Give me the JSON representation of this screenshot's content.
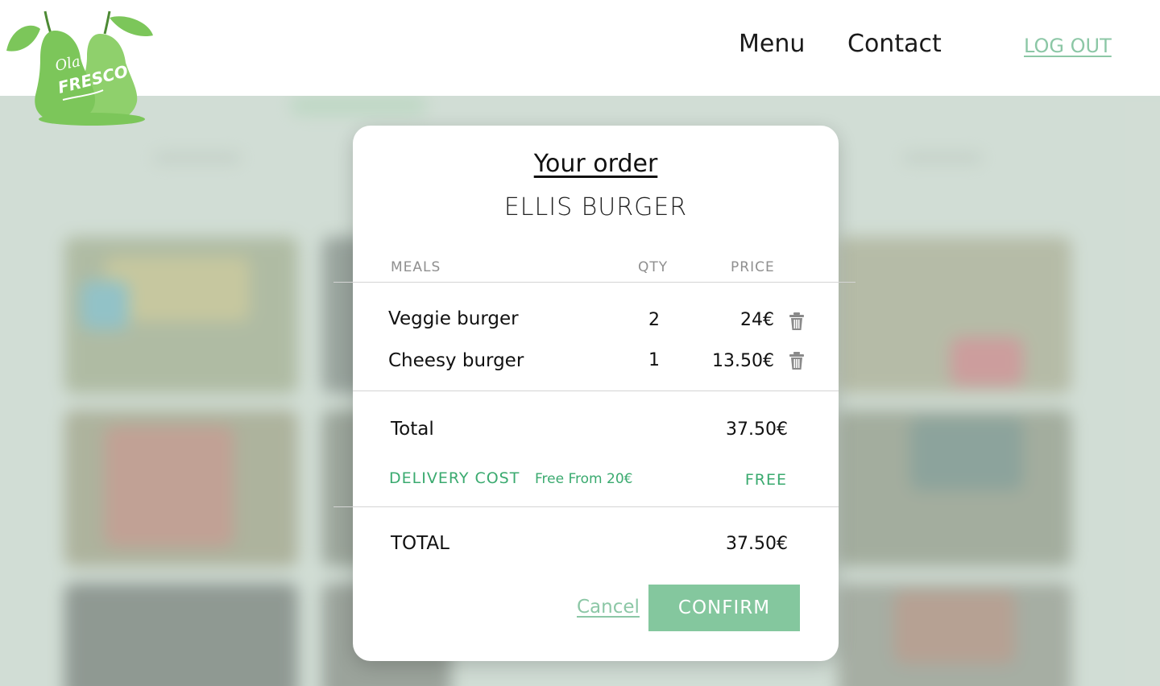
{
  "header": {
    "logo_alt": "Ola Fresco",
    "nav": {
      "menu": "Menu",
      "contact": "Contact"
    },
    "logout": "LOG OUT"
  },
  "modal": {
    "title": "Your order",
    "restaurant": "ELLIS BURGER",
    "columns": {
      "meals": "MEALS",
      "qty": "QTY",
      "price": "PRICE"
    },
    "items": [
      {
        "name": "Veggie burger",
        "qty": "2",
        "price": "24€"
      },
      {
        "name": "Cheesy burger",
        "qty": "1",
        "price": "13.50€"
      }
    ],
    "subtotal_label": "Total",
    "subtotal_value": "37.50€",
    "delivery": {
      "label": "DELIVERY COST",
      "note": "Free From 20€",
      "value": "FREE"
    },
    "total_label": "TOTAL",
    "total_value": "37.50€",
    "cancel_label": "Cancel",
    "confirm_label": "CONFIRM"
  },
  "colors": {
    "accent": "#84c79e",
    "delivery_text": "#3aaa6f",
    "logo_green": "#7cc65a"
  }
}
